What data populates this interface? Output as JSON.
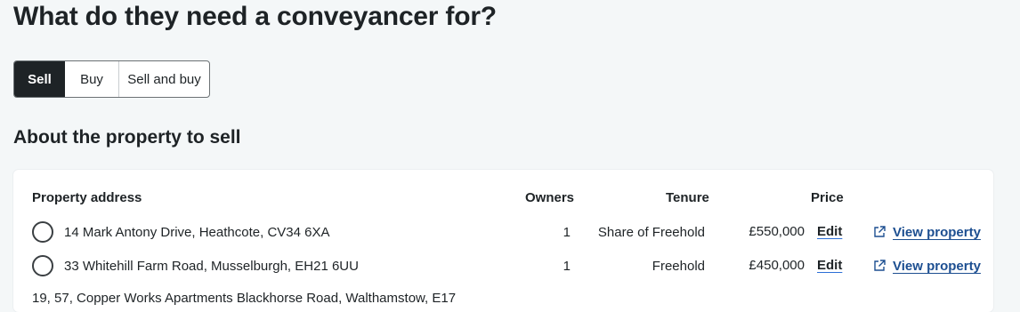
{
  "page": {
    "title": "What do they need a conveyancer for?",
    "section_title": "About the property to sell"
  },
  "segments": [
    {
      "label": "Sell",
      "selected": true
    },
    {
      "label": "Buy",
      "selected": false
    },
    {
      "label": "Sell and buy",
      "selected": false
    }
  ],
  "table": {
    "headers": {
      "address": "Property address",
      "owners": "Owners",
      "tenure": "Tenure",
      "price": "Price"
    },
    "rows": [
      {
        "address": "14 Mark Antony Drive, Heathcote, CV34 6XA",
        "owners": "1",
        "tenure": "Share of Freehold",
        "price": "£550,000",
        "edit_label": "Edit",
        "view_label": "View property",
        "selected": false
      },
      {
        "address": "33 Whitehill Farm Road, Musselburgh, EH21 6UU",
        "owners": "1",
        "tenure": "Freehold",
        "price": "£450,000",
        "edit_label": "Edit",
        "view_label": "View property",
        "selected": false
      },
      {
        "address": "19, 57, Copper Works Apartments Blackhorse Road, Walthamstow, E17"
      }
    ]
  },
  "icons": {
    "radio": "radio-button-icon",
    "external": "external-link-icon"
  },
  "colors": {
    "background": "#f4f7f8",
    "selected_segment": "#1e2326",
    "link": "#1d4f91",
    "edit_underline": "#2c6fd6"
  }
}
